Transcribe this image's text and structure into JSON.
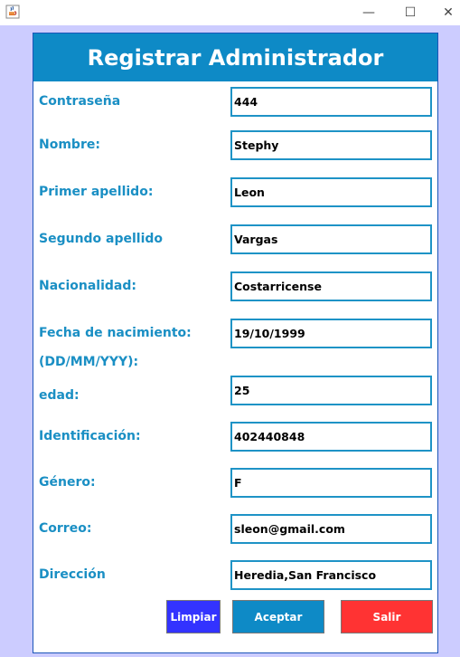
{
  "window": {
    "icon": "java-icon",
    "controls": {
      "minimize": "—",
      "maximize": "☐",
      "close": "✕"
    }
  },
  "form": {
    "title": "Registrar Administrador",
    "labels": {
      "password": "Contraseña",
      "name": "Nombre:",
      "first_lastname": "Primer apellido:",
      "second_lastname": "Segundo apellido",
      "nationality": "Nacionalidad:",
      "birthdate": "Fecha de nacimiento:",
      "birthdate_format": "(DD/MM/YYY):",
      "age": "edad:",
      "identification": "Identificación:",
      "gender": "Género:",
      "email": "Correo:",
      "address": "Dirección"
    },
    "values": {
      "password": "444",
      "name": "Stephy",
      "first_lastname": "Leon",
      "second_lastname": "Vargas",
      "nationality": "Costarricense",
      "birthdate": "19/10/1999",
      "age": "25",
      "identification": "402440848",
      "gender": "F",
      "email": "sleon@gmail.com",
      "address": "Heredia,San Francisco"
    },
    "buttons": {
      "clear": "Limpiar",
      "accept": "Aceptar",
      "exit": "Salir"
    }
  },
  "colors": {
    "header_bg": "#0e8ac6",
    "label_text": "#1a8fc4",
    "field_border": "#1e93c6",
    "window_bg": "#ccccff",
    "clear_button": "#3333ff",
    "accept_button": "#0e8ac6",
    "exit_button": "#ff3333"
  }
}
